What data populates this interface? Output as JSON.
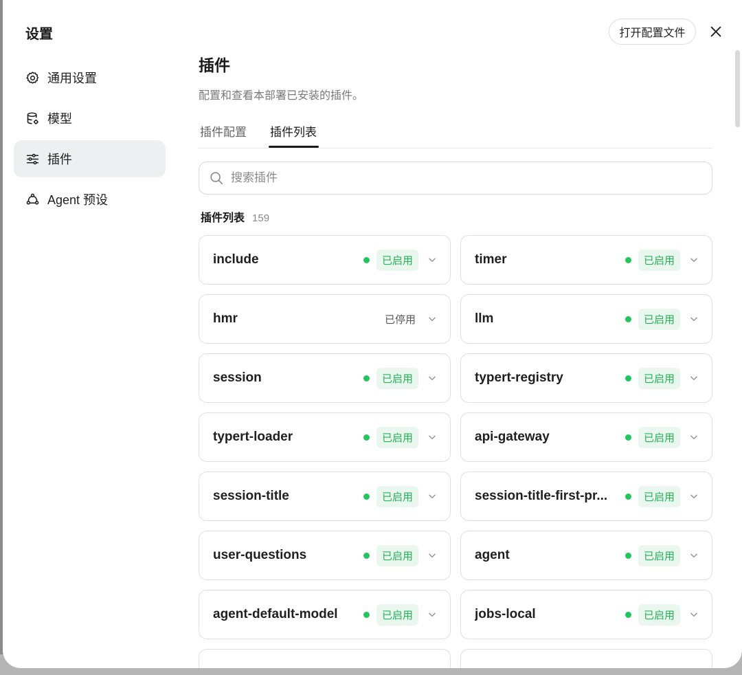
{
  "dialog": {
    "title": "设置",
    "open_config_label": "打开配置文件"
  },
  "sidebar": {
    "items": [
      {
        "label": "通用设置",
        "icon": "gear-icon"
      },
      {
        "label": "模型",
        "icon": "database-icon"
      },
      {
        "label": "插件",
        "icon": "sliders-icon",
        "active": true
      },
      {
        "label": "Agent 预设",
        "icon": "agent-icon"
      }
    ]
  },
  "main": {
    "title": "插件",
    "description": "配置和查看本部署已安装的插件。",
    "tabs": [
      {
        "label": "插件配置"
      },
      {
        "label": "插件列表",
        "active": true
      }
    ],
    "search_placeholder": "搜索插件",
    "list_title": "插件列表",
    "list_count": "159"
  },
  "status_colors": {
    "enabled_dot": "#22c55e",
    "enabled_badge_bg": "#e9f7ee",
    "enabled_badge_text": "#22b355"
  },
  "plugins": [
    {
      "name": "include",
      "status": "已启用",
      "enabled": true
    },
    {
      "name": "timer",
      "status": "已启用",
      "enabled": true
    },
    {
      "name": "hmr",
      "status": "已停用",
      "enabled": false
    },
    {
      "name": "llm",
      "status": "已启用",
      "enabled": true
    },
    {
      "name": "session",
      "status": "已启用",
      "enabled": true
    },
    {
      "name": "typert-registry",
      "status": "已启用",
      "enabled": true
    },
    {
      "name": "typert-loader",
      "status": "已启用",
      "enabled": true
    },
    {
      "name": "api-gateway",
      "status": "已启用",
      "enabled": true
    },
    {
      "name": "session-title",
      "status": "已启用",
      "enabled": true
    },
    {
      "name": "session-title-first-pr...",
      "status": "已启用",
      "enabled": true
    },
    {
      "name": "user-questions",
      "status": "已启用",
      "enabled": true
    },
    {
      "name": "agent",
      "status": "已启用",
      "enabled": true
    },
    {
      "name": "agent-default-model",
      "status": "已启用",
      "enabled": true
    },
    {
      "name": "jobs-local",
      "status": "已启用",
      "enabled": true
    }
  ]
}
